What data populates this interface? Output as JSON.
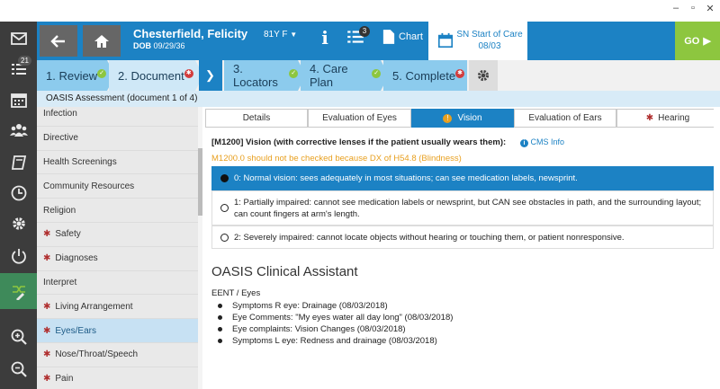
{
  "window": {
    "minimize": "–",
    "maximize": "▫",
    "close": "✕"
  },
  "rail": {
    "badge": "21"
  },
  "header": {
    "patient_name": "Chesterfield, Felicity",
    "dob_label": "DOB",
    "dob": "09/29/36",
    "age": "81Y F",
    "list_badge": "3",
    "chart_label": "Chart",
    "visit_title": "SN Start of Care",
    "visit_date": "08/03",
    "go_label": "GO"
  },
  "steps": [
    {
      "label": "1. Review",
      "status": "ok"
    },
    {
      "label": "2. Document",
      "status": "error"
    },
    {
      "label": "3. Locators",
      "status": "ok"
    },
    {
      "label": "4. Care Plan",
      "status": "ok"
    },
    {
      "label": "5. Complete",
      "status": "error"
    }
  ],
  "assessment_label": "OASIS Assessment (document 1 of 4)",
  "sidebar": [
    {
      "label": "Infection",
      "required": false
    },
    {
      "label": "Directive",
      "required": false
    },
    {
      "label": "Health Screenings",
      "required": false
    },
    {
      "label": "Community Resources",
      "required": false
    },
    {
      "label": "Religion",
      "required": false
    },
    {
      "label": "Safety",
      "required": true
    },
    {
      "label": "Diagnoses",
      "required": true
    },
    {
      "label": "Interpret",
      "required": false
    },
    {
      "label": "Living Arrangement",
      "required": true
    },
    {
      "label": "Eyes/Ears",
      "required": true
    },
    {
      "label": "Nose/Throat/Speech",
      "required": true
    },
    {
      "label": "Pain",
      "required": true
    }
  ],
  "tabs": [
    {
      "label": "Details"
    },
    {
      "label": "Evaluation of Eyes"
    },
    {
      "label": "Vision"
    },
    {
      "label": "Evaluation of Ears"
    },
    {
      "label": "Hearing"
    }
  ],
  "question": {
    "title": "[M1200] Vision (with corrective lenses if the patient usually wears them):",
    "cms_link": "CMS Info",
    "warning": "M1200.0 should not be checked because DX of H54.8 (Blindness)",
    "options": [
      "0: Normal vision: sees adequately in most situations; can see medication labels, newsprint.",
      "1: Partially impaired: cannot see medication labels or newsprint, but CAN see obstacles in path, and the surrounding layout; can count fingers at arm's length.",
      "2: Severely impaired: cannot locate objects without hearing or touching them, or patient nonresponsive."
    ],
    "selected_index": 0
  },
  "clinical_assistant": {
    "title": "OASIS Clinical Assistant",
    "section": "EENT / Eyes",
    "items": [
      "Symptoms R eye: Drainage (08/03/2018)",
      "Eye Comments: \"My eyes water all day long\" (08/03/2018)",
      "Eye complaints: Vision Changes (08/03/2018)",
      "Symptoms L eye: Redness and drainage (08/03/2018)"
    ]
  },
  "colors": {
    "header": "#1c82c4",
    "go": "#8dc63f",
    "step": "#8ccbed",
    "warning": "#e8a020"
  }
}
